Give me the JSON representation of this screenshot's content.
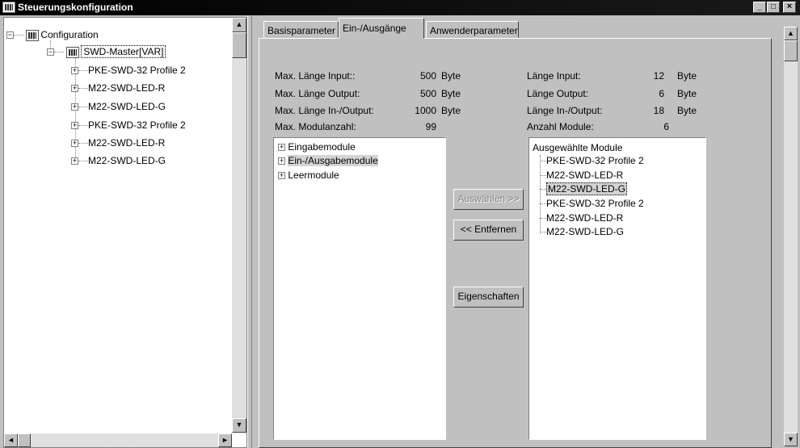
{
  "window": {
    "title": "Steuerungskonfiguration",
    "minimize": "_",
    "maximize": "□",
    "close": "×"
  },
  "tree": {
    "root": {
      "expander": "−",
      "label": "Configuration"
    },
    "master": {
      "expander": "−",
      "label": "SWD-Master[VAR]"
    },
    "children": [
      {
        "expander": "+",
        "label": "PKE-SWD-32 Profile 2"
      },
      {
        "expander": "+",
        "label": "M22-SWD-LED-R"
      },
      {
        "expander": "+",
        "label": "M22-SWD-LED-G"
      },
      {
        "expander": "+",
        "label": "PKE-SWD-32 Profile 2"
      },
      {
        "expander": "+",
        "label": "M22-SWD-LED-R"
      },
      {
        "expander": "+",
        "label": "M22-SWD-LED-G"
      }
    ]
  },
  "tabs": [
    {
      "label": "Basisparameter",
      "active": false
    },
    {
      "label": "Ein-/Ausgänge",
      "active": true
    },
    {
      "label": "Anwenderparameter",
      "active": false
    }
  ],
  "limits": {
    "max_input_label": "Max. Länge Input::",
    "max_input_value": "500",
    "max_output_label": "Max. Länge Output:",
    "max_output_value": "500",
    "max_inout_label": "Max. Länge In-/Output:",
    "max_inout_value": "1000",
    "max_modules_label": "Max. Modulanzahl:",
    "max_modules_value": "99",
    "unit": "Byte"
  },
  "current": {
    "input_label": "Länge Input:",
    "input_value": "12",
    "output_label": "Länge Output:",
    "output_value": "6",
    "inout_label": "Länge In-/Output:",
    "inout_value": "18",
    "modules_label": "Anzahl Module:",
    "modules_value": "6",
    "unit": "Byte"
  },
  "available_modules": [
    {
      "expander": "+",
      "label": "Eingabemodule",
      "highlighted": false
    },
    {
      "expander": "+",
      "label": "Ein-/Ausgabemodule",
      "highlighted": true
    },
    {
      "expander": "+",
      "label": "Leermodule",
      "highlighted": false
    }
  ],
  "buttons": {
    "select": "Auswählen >>",
    "remove": "<< Entfernen",
    "properties": "Eigenschaften"
  },
  "selected_modules": {
    "header": "Ausgewählte Module",
    "items": [
      {
        "label": "PKE-SWD-32 Profile 2",
        "highlighted": false
      },
      {
        "label": "M22-SWD-LED-R",
        "highlighted": false
      },
      {
        "label": "M22-SWD-LED-G",
        "highlighted": true
      },
      {
        "label": "PKE-SWD-32 Profile 2",
        "highlighted": false
      },
      {
        "label": "M22-SWD-LED-R",
        "highlighted": false
      },
      {
        "label": "M22-SWD-LED-G",
        "highlighted": false
      }
    ]
  },
  "scroll": {
    "up": "▲",
    "down": "▼",
    "left": "◄",
    "right": "►"
  }
}
